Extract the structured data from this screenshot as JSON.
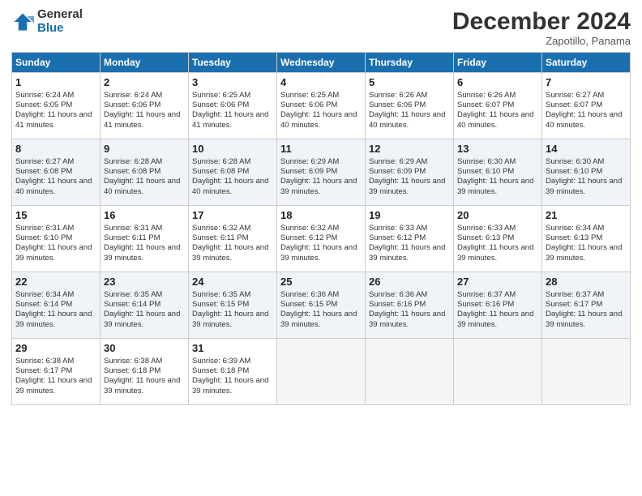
{
  "header": {
    "logo_general": "General",
    "logo_blue": "Blue",
    "month_title": "December 2024",
    "location": "Zapotillo, Panama"
  },
  "days_of_week": [
    "Sunday",
    "Monday",
    "Tuesday",
    "Wednesday",
    "Thursday",
    "Friday",
    "Saturday"
  ],
  "weeks": [
    [
      {
        "day": 1,
        "sunrise": "6:24 AM",
        "sunset": "6:05 PM",
        "daylight": "11 hours and 41 minutes."
      },
      {
        "day": 2,
        "sunrise": "6:24 AM",
        "sunset": "6:06 PM",
        "daylight": "11 hours and 41 minutes."
      },
      {
        "day": 3,
        "sunrise": "6:25 AM",
        "sunset": "6:06 PM",
        "daylight": "11 hours and 41 minutes."
      },
      {
        "day": 4,
        "sunrise": "6:25 AM",
        "sunset": "6:06 PM",
        "daylight": "11 hours and 40 minutes."
      },
      {
        "day": 5,
        "sunrise": "6:26 AM",
        "sunset": "6:06 PM",
        "daylight": "11 hours and 40 minutes."
      },
      {
        "day": 6,
        "sunrise": "6:26 AM",
        "sunset": "6:07 PM",
        "daylight": "11 hours and 40 minutes."
      },
      {
        "day": 7,
        "sunrise": "6:27 AM",
        "sunset": "6:07 PM",
        "daylight": "11 hours and 40 minutes."
      }
    ],
    [
      {
        "day": 8,
        "sunrise": "6:27 AM",
        "sunset": "6:08 PM",
        "daylight": "11 hours and 40 minutes."
      },
      {
        "day": 9,
        "sunrise": "6:28 AM",
        "sunset": "6:08 PM",
        "daylight": "11 hours and 40 minutes."
      },
      {
        "day": 10,
        "sunrise": "6:28 AM",
        "sunset": "6:08 PM",
        "daylight": "11 hours and 40 minutes."
      },
      {
        "day": 11,
        "sunrise": "6:29 AM",
        "sunset": "6:09 PM",
        "daylight": "11 hours and 39 minutes."
      },
      {
        "day": 12,
        "sunrise": "6:29 AM",
        "sunset": "6:09 PM",
        "daylight": "11 hours and 39 minutes."
      },
      {
        "day": 13,
        "sunrise": "6:30 AM",
        "sunset": "6:10 PM",
        "daylight": "11 hours and 39 minutes."
      },
      {
        "day": 14,
        "sunrise": "6:30 AM",
        "sunset": "6:10 PM",
        "daylight": "11 hours and 39 minutes."
      }
    ],
    [
      {
        "day": 15,
        "sunrise": "6:31 AM",
        "sunset": "6:10 PM",
        "daylight": "11 hours and 39 minutes."
      },
      {
        "day": 16,
        "sunrise": "6:31 AM",
        "sunset": "6:11 PM",
        "daylight": "11 hours and 39 minutes."
      },
      {
        "day": 17,
        "sunrise": "6:32 AM",
        "sunset": "6:11 PM",
        "daylight": "11 hours and 39 minutes."
      },
      {
        "day": 18,
        "sunrise": "6:32 AM",
        "sunset": "6:12 PM",
        "daylight": "11 hours and 39 minutes."
      },
      {
        "day": 19,
        "sunrise": "6:33 AM",
        "sunset": "6:12 PM",
        "daylight": "11 hours and 39 minutes."
      },
      {
        "day": 20,
        "sunrise": "6:33 AM",
        "sunset": "6:13 PM",
        "daylight": "11 hours and 39 minutes."
      },
      {
        "day": 21,
        "sunrise": "6:34 AM",
        "sunset": "6:13 PM",
        "daylight": "11 hours and 39 minutes."
      }
    ],
    [
      {
        "day": 22,
        "sunrise": "6:34 AM",
        "sunset": "6:14 PM",
        "daylight": "11 hours and 39 minutes."
      },
      {
        "day": 23,
        "sunrise": "6:35 AM",
        "sunset": "6:14 PM",
        "daylight": "11 hours and 39 minutes."
      },
      {
        "day": 24,
        "sunrise": "6:35 AM",
        "sunset": "6:15 PM",
        "daylight": "11 hours and 39 minutes."
      },
      {
        "day": 25,
        "sunrise": "6:36 AM",
        "sunset": "6:15 PM",
        "daylight": "11 hours and 39 minutes."
      },
      {
        "day": 26,
        "sunrise": "6:36 AM",
        "sunset": "6:16 PM",
        "daylight": "11 hours and 39 minutes."
      },
      {
        "day": 27,
        "sunrise": "6:37 AM",
        "sunset": "6:16 PM",
        "daylight": "11 hours and 39 minutes."
      },
      {
        "day": 28,
        "sunrise": "6:37 AM",
        "sunset": "6:17 PM",
        "daylight": "11 hours and 39 minutes."
      }
    ],
    [
      {
        "day": 29,
        "sunrise": "6:38 AM",
        "sunset": "6:17 PM",
        "daylight": "11 hours and 39 minutes."
      },
      {
        "day": 30,
        "sunrise": "6:38 AM",
        "sunset": "6:18 PM",
        "daylight": "11 hours and 39 minutes."
      },
      {
        "day": 31,
        "sunrise": "6:39 AM",
        "sunset": "6:18 PM",
        "daylight": "11 hours and 39 minutes."
      },
      null,
      null,
      null,
      null
    ]
  ]
}
